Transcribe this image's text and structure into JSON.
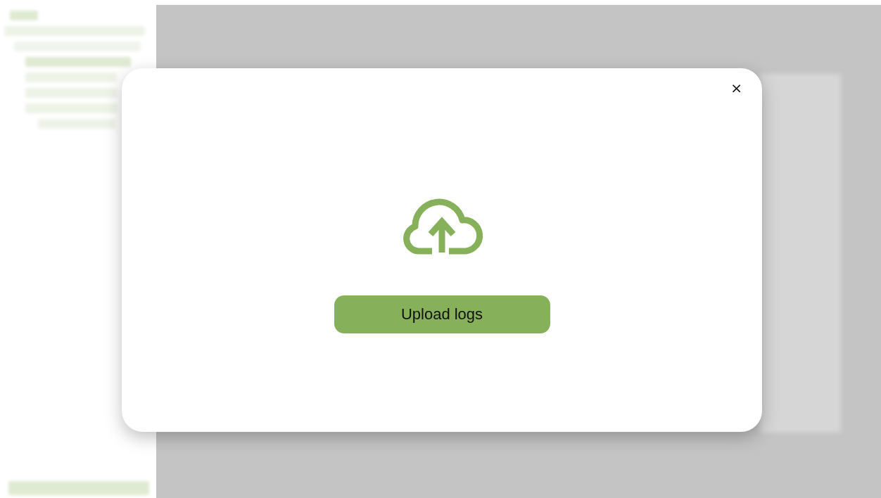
{
  "dialog": {
    "close_button": "×",
    "upload_button": "Upload logs"
  }
}
